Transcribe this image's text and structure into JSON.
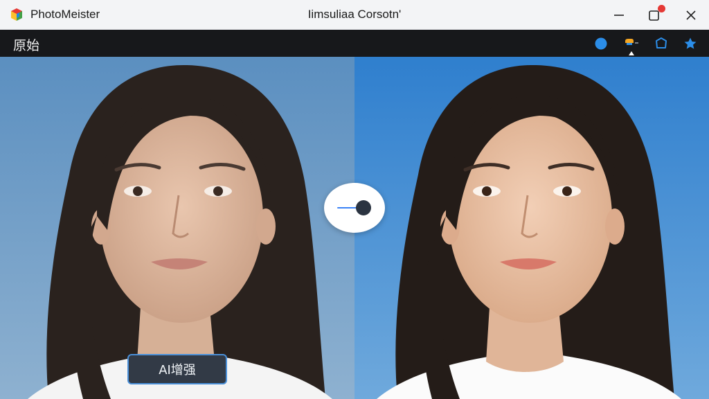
{
  "window": {
    "app_name": "PhotoMeister",
    "title": "Iimsuliaa Corsotn'",
    "controls": [
      "minimize-icon",
      "maximize-icon",
      "close-icon"
    ],
    "notification_color": "#e53935"
  },
  "toolbar": {
    "view_label": "原始",
    "tools": [
      "circle-tool-icon",
      "brush-tool-icon",
      "shape-tool-icon",
      "star-icon"
    ],
    "accent_color": "#2b8de8",
    "brush_color": "#f5a623",
    "active_tool": "brush-tool-icon"
  },
  "viewer": {
    "left_pane": "original photo",
    "right_pane": "enhanced photo",
    "compare_slider_icon": "compare-slider-icon",
    "ai_button_label": "AI增强"
  }
}
